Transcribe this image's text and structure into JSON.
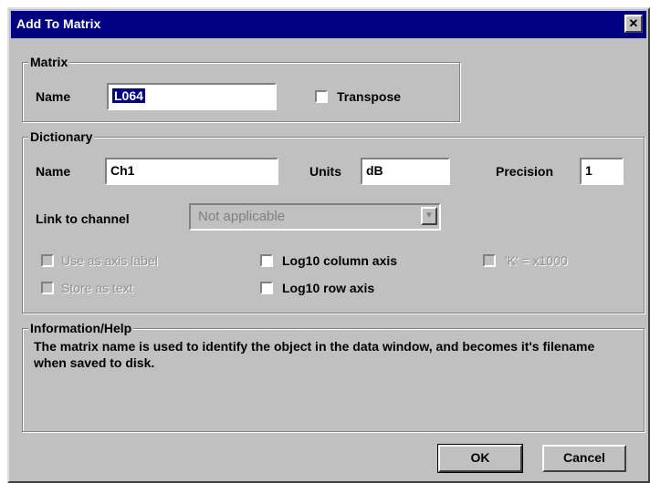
{
  "window": {
    "title": "Add To Matrix",
    "close_label": "✕"
  },
  "matrix": {
    "group_label": "Matrix",
    "name_label": "Name",
    "name_value": "L064",
    "transpose_label": "Transpose",
    "transpose_checked": false
  },
  "dictionary": {
    "group_label": "Dictionary",
    "name_label": "Name",
    "name_value": "Ch1",
    "units_label": "Units",
    "units_value": "dB",
    "precision_label": "Precision",
    "precision_value": "1",
    "link_label": "Link to channel",
    "link_value": "Not applicable",
    "use_axis_label": "Use as axis label",
    "store_text_label": "Store as text",
    "log10_column_label": "Log10 column axis",
    "log10_row_label": "Log10 row axis",
    "k_label": "'K' = x1000"
  },
  "help": {
    "group_label": "Information/Help",
    "text": "The matrix name is used to identify the object in the data window, and becomes it's filename when saved to disk."
  },
  "buttons": {
    "ok": "OK",
    "cancel": "Cancel"
  },
  "colors": {
    "titlebar": "#000080",
    "face": "#c0c0c0"
  }
}
